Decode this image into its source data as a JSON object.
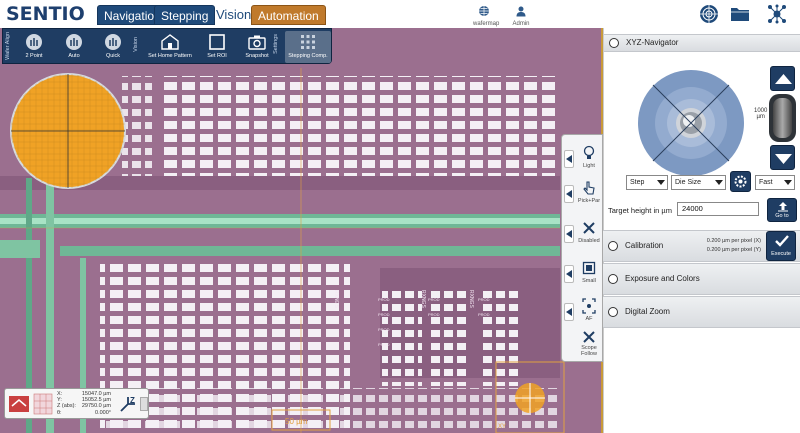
{
  "app": {
    "logo": "SENTIO"
  },
  "nav": {
    "tabs": [
      {
        "label": "Navigation"
      },
      {
        "label": "Stepping"
      },
      {
        "label": "Vision"
      },
      {
        "label": "Automation"
      }
    ],
    "icons": [
      {
        "name": "waferapp-icon",
        "caption": "wafermap"
      },
      {
        "name": "admin-icon",
        "caption": "Admin"
      }
    ]
  },
  "toolbar": {
    "group_wafer_align": "Wafer Align",
    "group_vision": "Vision",
    "group_settings": "Settings",
    "buttons": [
      {
        "label": "2 Point"
      },
      {
        "label": "Auto"
      },
      {
        "label": "Quick"
      },
      {
        "label": "Set Home Pattern"
      },
      {
        "label": "Set ROI"
      },
      {
        "label": "Snapshot"
      },
      {
        "label": "Stepping Comp."
      }
    ]
  },
  "side_tools": [
    {
      "label": "Light"
    },
    {
      "label": "Pick+Par"
    },
    {
      "label": "Disabled"
    },
    {
      "label": "Small"
    },
    {
      "label": "AF"
    },
    {
      "label": "Scope Follow"
    }
  ],
  "readout": {
    "labels": [
      "X:",
      "Y:",
      "Z (abs):",
      "θ:"
    ],
    "values": [
      "15047.0 µm",
      "15052.5 µm",
      "29750.0 µm",
      "0.000°"
    ]
  },
  "image_labels": {
    "scale_bar": "50 µm",
    "xy_corner": "XY",
    "die_labels": [
      "RXNGS",
      "RXNGS",
      "RXNGS"
    ],
    "bond_labels": [
      "PROD",
      "PROD",
      "PROD",
      "PROD",
      "PROD",
      "PROD",
      "PROD",
      "PROD"
    ]
  },
  "xyz_navigator": {
    "title": "XYZ-Navigator",
    "jog_scale": "1000",
    "jog_unit": "µm",
    "step_mode": "Step",
    "step_size": "Die Size",
    "speed": "Fast",
    "target_height_label": "Target height in µm",
    "target_height_value": "24000",
    "go_to_label": "Go to",
    "execute_label": "Execute"
  },
  "sections": [
    {
      "title": "Calibration",
      "detail1": "0.200 µm per pixel (X)",
      "detail2": "0.200 µm per pixel (Y)"
    },
    {
      "title": "Exposure and Colors"
    },
    {
      "title": "Digital Zoom"
    }
  ],
  "colors": {
    "navy": "#1f3d63",
    "accent_orange": "#c07a2c",
    "wafer_purple": "#9b6f8f",
    "mint": "#8fd1b0"
  }
}
